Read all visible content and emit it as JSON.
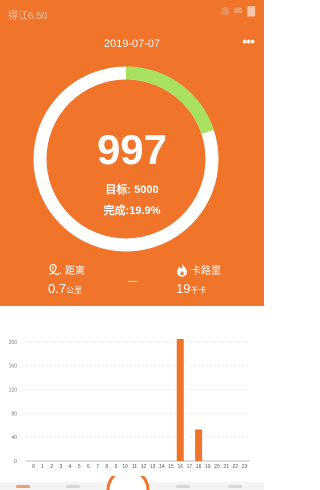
{
  "status": {
    "left": "得江6.50",
    "right": "◎ ✉ ▇"
  },
  "header": {
    "date": "2019-07-07",
    "more": "•••"
  },
  "ring": {
    "steps": "997",
    "goal": "目标: 5000",
    "completion": "完成:19.9%",
    "progress": 0.199
  },
  "stats": {
    "distance": {
      "label": "距离",
      "value": "0.7",
      "unit": "公里"
    },
    "middle": {
      "value": "—"
    },
    "calories": {
      "label": "卡路里",
      "value": "19",
      "unit": "千卡"
    }
  },
  "colors": {
    "accent": "#F0742A",
    "ring_track": "#FFFFFF",
    "ring_progress": "#A8E05F"
  },
  "icons": {
    "distance": "map-pin-icon",
    "calories": "flame-icon"
  },
  "chart_data": {
    "type": "bar",
    "categories": [
      "0",
      "1",
      "2",
      "3",
      "4",
      "5",
      "6",
      "7",
      "8",
      "9",
      "10",
      "11",
      "12",
      "13",
      "14",
      "15",
      "16",
      "17",
      "18",
      "19",
      "20",
      "21",
      "22",
      "23"
    ],
    "values": [
      0,
      0,
      0,
      0,
      0,
      0,
      0,
      0,
      0,
      0,
      0,
      0,
      0,
      0,
      0,
      0,
      205,
      0,
      53,
      0,
      0,
      0,
      0,
      0
    ],
    "yticks": [
      "0",
      "40",
      "80",
      "120",
      "160",
      "200"
    ],
    "ylim": [
      0,
      220
    ],
    "grid": true,
    "color": "#F0742A"
  }
}
